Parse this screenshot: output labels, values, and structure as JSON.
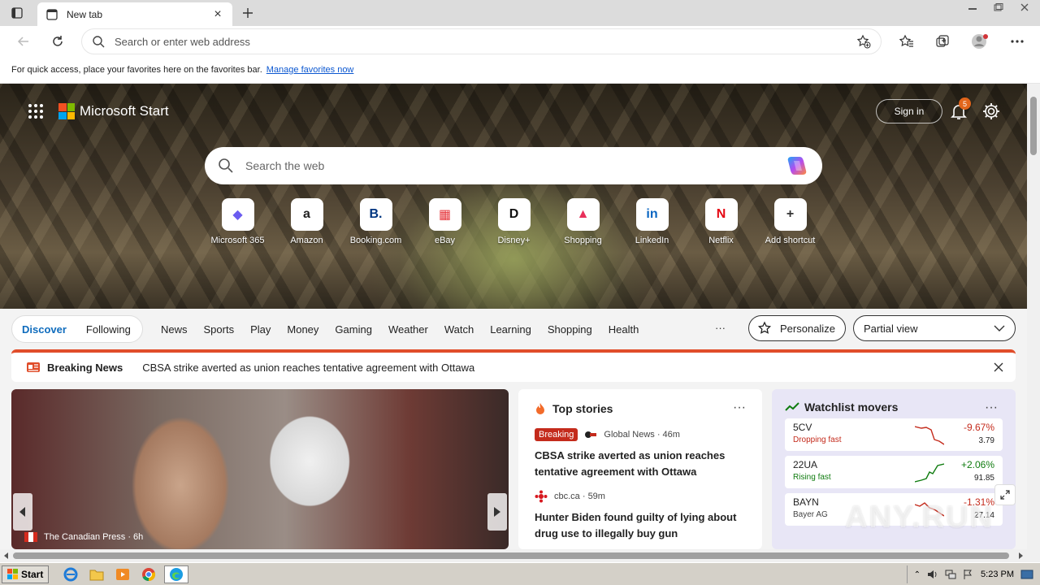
{
  "browser": {
    "tab_title": "New tab",
    "address_placeholder": "Search or enter web address"
  },
  "favorites_bar": {
    "message": "For quick access, place your favorites here on the favorites bar.",
    "link": "Manage favorites now"
  },
  "hero": {
    "brand": "Microsoft Start",
    "sign_in": "Sign in",
    "notifications_count": "5",
    "search_placeholder": "Search the web",
    "shortcuts": [
      {
        "label": "Microsoft 365",
        "icon": "microsoft-365-icon",
        "glyph": "◆",
        "color": "#6b5cf0"
      },
      {
        "label": "Amazon",
        "icon": "amazon-icon",
        "glyph": "a",
        "color": "#222222"
      },
      {
        "label": "Booking.com",
        "icon": "booking-icon",
        "glyph": "B.",
        "color": "#003580"
      },
      {
        "label": "eBay",
        "icon": "ebay-icon",
        "glyph": "▦",
        "color": "#e53238"
      },
      {
        "label": "Disney+",
        "icon": "disney-icon",
        "glyph": "D",
        "color": "#111111"
      },
      {
        "label": "Shopping",
        "icon": "shopping-bag-icon",
        "glyph": "▲",
        "color": "#e8305a"
      },
      {
        "label": "LinkedIn",
        "icon": "linkedin-icon",
        "glyph": "in",
        "color": "#0a66c2"
      },
      {
        "label": "Netflix",
        "icon": "netflix-icon",
        "glyph": "N",
        "color": "#e50914"
      },
      {
        "label": "Add shortcut",
        "icon": "plus-icon",
        "glyph": "+",
        "color": "#333333"
      }
    ]
  },
  "nav": {
    "discover": "Discover",
    "following": "Following",
    "links": [
      "News",
      "Sports",
      "Play",
      "Money",
      "Gaming",
      "Weather",
      "Watch",
      "Learning",
      "Shopping",
      "Health"
    ],
    "more": "···",
    "personalize": "Personalize",
    "view": "Partial view"
  },
  "breaking": {
    "label": "Breaking News",
    "text": "CBSA strike averted as union reaches tentative agreement with Ottawa"
  },
  "hero_card": {
    "source": "The Canadian Press · 6h"
  },
  "top_stories": {
    "title": "Top stories",
    "more": "···",
    "items": [
      {
        "tag": "Breaking",
        "source": "Global News · 46m",
        "title": "CBSA strike averted as union reaches tentative agreement with Ottawa"
      },
      {
        "tag": "",
        "source": "cbc.ca · 59m",
        "title": "Hunter Biden found guilty of lying about drug use to illegally buy gun"
      }
    ]
  },
  "watchlist": {
    "title": "Watchlist movers",
    "more": "···",
    "rows": [
      {
        "symbol": "5CV",
        "sub": "Dropping fast",
        "change": "-9.67%",
        "price": "3.79",
        "color": "#c42b1c"
      },
      {
        "symbol": "22UA",
        "sub": "Rising fast",
        "change": "+2.06%",
        "price": "91.85",
        "color": "#107c10"
      },
      {
        "symbol": "BAYN",
        "sub": "Bayer AG",
        "change": "-1.31%",
        "price": "27.14",
        "color": "#c42b1c"
      }
    ]
  },
  "watermark": "ANY.RUN",
  "taskbar": {
    "start": "Start",
    "time": "5:23 PM"
  }
}
